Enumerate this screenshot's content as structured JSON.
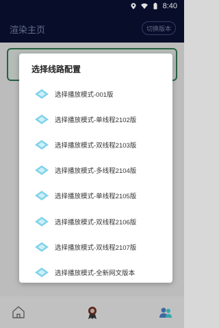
{
  "status_bar": {
    "time": "8:40"
  },
  "app_bar": {
    "title": "渲染主页",
    "switch_label": "切换版本"
  },
  "dialog": {
    "title": "选择线路配置",
    "options": [
      "选择播放模式-001版",
      "选择播放模式-单线程2102版",
      "选择播放模式-双线程2103版",
      "选择播放模式-多线程2104版",
      "选择播放模式-单线程2105版",
      "选择播放模式-双线程2106版",
      "选择播放模式-双线程2107版",
      "选择播放模式-全新网文版本"
    ]
  },
  "colors": {
    "accent_diamond": "#7fd3ea",
    "app_bar": "#0a1030",
    "card_border": "#2d6f4a"
  },
  "icons": [
    "location-icon",
    "wifi-icon",
    "battery-icon",
    "home-icon",
    "award-icon",
    "users-icon",
    "diamond-icon"
  ]
}
